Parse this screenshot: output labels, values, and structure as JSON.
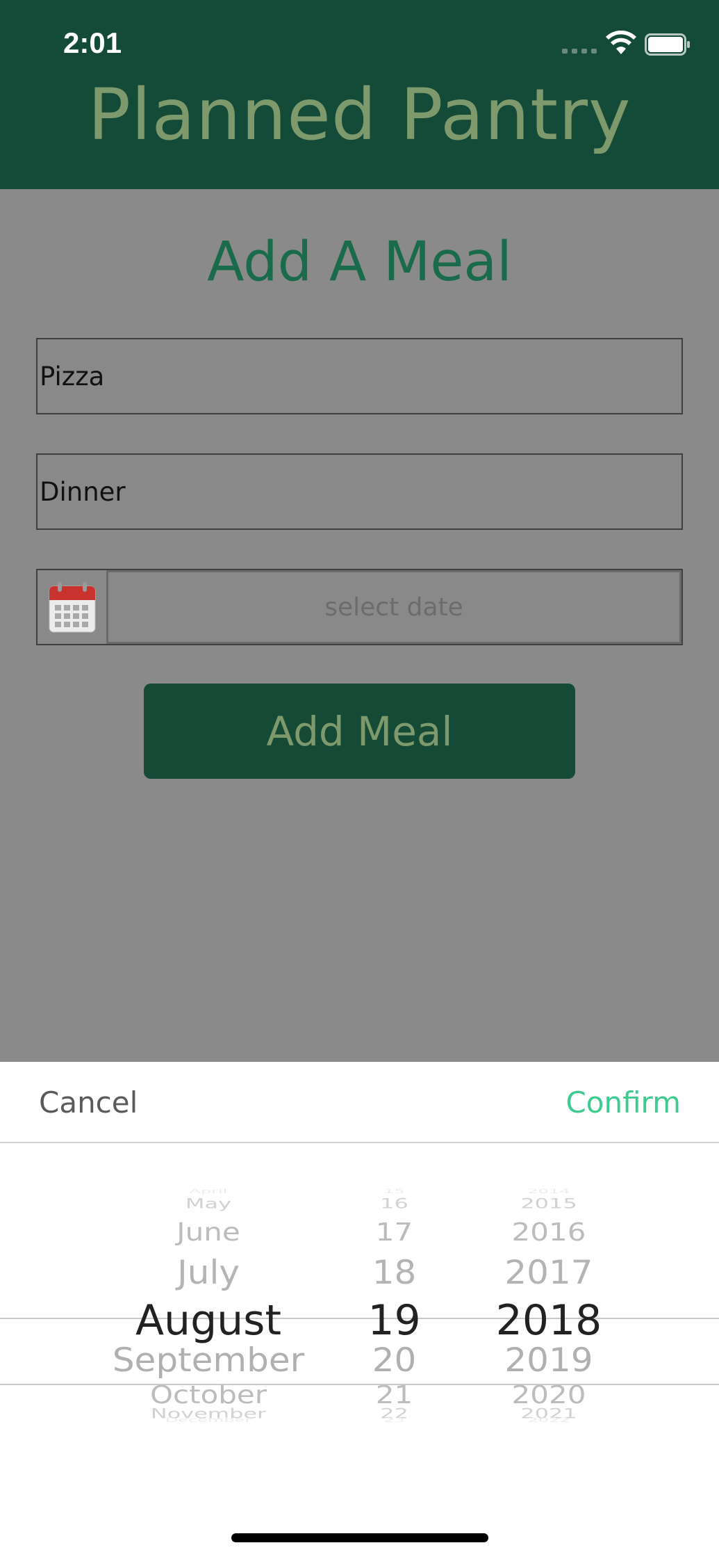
{
  "status_bar": {
    "time": "2:01"
  },
  "header": {
    "title": "Planned Pantry"
  },
  "form": {
    "title": "Add A Meal",
    "meal_name_value": "Pizza",
    "meal_type_value": "Dinner",
    "date_placeholder": "select date",
    "add_button_label": "Add Meal"
  },
  "picker": {
    "cancel_label": "Cancel",
    "confirm_label": "Confirm",
    "months": [
      "April",
      "May",
      "June",
      "July",
      "August",
      "September",
      "October",
      "November",
      "December"
    ],
    "days": [
      "15",
      "16",
      "17",
      "18",
      "19",
      "20",
      "21",
      "22",
      "23"
    ],
    "years": [
      "2014",
      "2015",
      "2016",
      "2017",
      "2018",
      "2019",
      "2020",
      "2021",
      "2022"
    ],
    "selected_index": 4
  },
  "colors": {
    "header_bg": "#134a38",
    "title_accent": "#7e9a6d",
    "heading_green": "#1a6a4c",
    "confirm_green": "#3ecb90"
  }
}
